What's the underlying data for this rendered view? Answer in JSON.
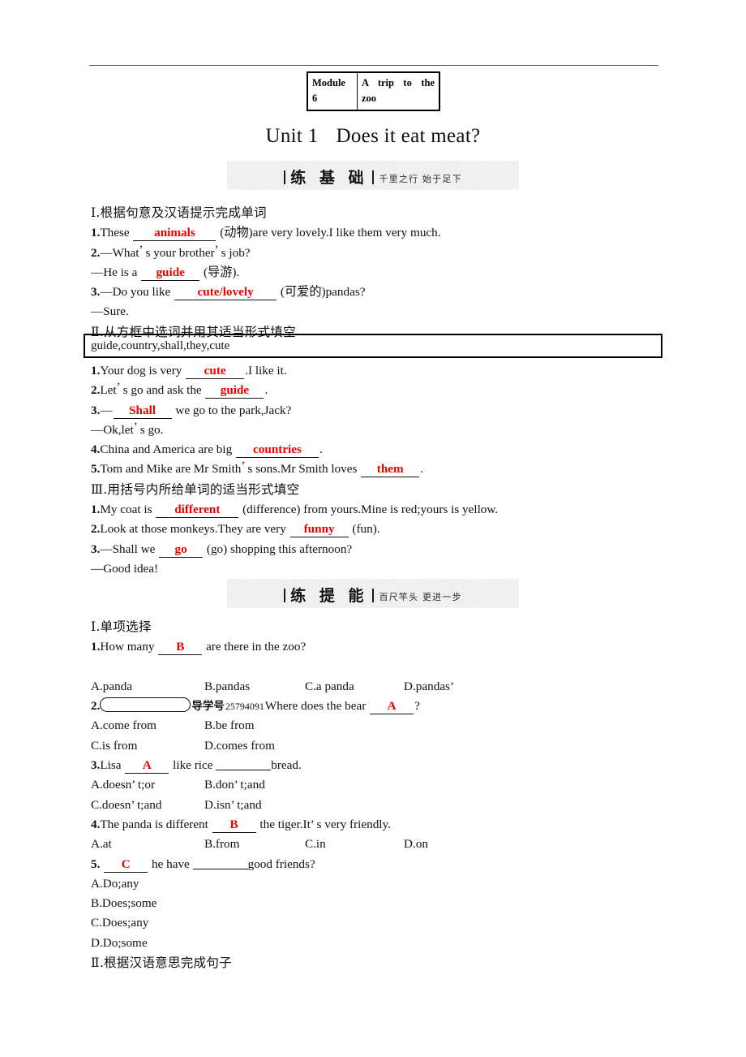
{
  "header": {
    "module_label": "Module",
    "module_number": "6",
    "module_topic_line1": "A trip to the",
    "module_topic_line2": "zoo"
  },
  "title": {
    "unit": "Unit 1",
    "name": "Does it eat meat?"
  },
  "banners": [
    {
      "name": "练 基 础",
      "motto": "千里之行  始于足下"
    },
    {
      "name": "练 提 能",
      "motto": "百尺竿头  更进一步"
    }
  ],
  "basics": {
    "section1": {
      "heading_numeral": "Ⅰ",
      "heading_text": ".根据句意及汉语提示完成单词",
      "items": [
        {
          "num": "1.",
          "pre": "These",
          "answer": "animals",
          "post": "(动物)are very lovely.I like them very much."
        },
        {
          "num": "2.",
          "q_pre": "—What",
          "q_mid": "s your brother",
          "q_post": "s job?",
          "a_pre": "—He is a",
          "answer": "guide",
          "a_post": "(导游)."
        },
        {
          "num": "3.",
          "q_pre": "—Do you like",
          "answer": "cute/lovely",
          "q_post": "(可爱的)pandas?",
          "reply": "—Sure."
        }
      ]
    },
    "section2": {
      "heading_numeral": "Ⅱ",
      "heading_text": ".从方框中选词并用其适当形式填空",
      "wordbank": "guide,country,shall,they,cute",
      "items": [
        {
          "num": "1.",
          "pre": "Your dog is very",
          "answer": "cute",
          "post": ".I like it."
        },
        {
          "num": "2.",
          "pre": "Let",
          "pre2": "s go and ask the",
          "answer": "guide",
          "post": "."
        },
        {
          "num": "3.",
          "pre": "—",
          "answer": "Shall",
          "post": "we go to the park,Jack?",
          "reply": "—Ok,let",
          "reply2": "s go."
        },
        {
          "num": "4.",
          "pre": "China and America are big",
          "answer": "countries",
          "post": "."
        },
        {
          "num": "5.",
          "pre": "Tom and Mike are Mr Smith",
          "pre2": "s sons.Mr Smith loves",
          "answer": "them",
          "post": "."
        }
      ]
    },
    "section3": {
      "heading_numeral": "Ⅲ",
      "heading_text": ".用括号内所给单词的适当形式填空",
      "items": [
        {
          "num": "1.",
          "pre": "My coat is",
          "answer": "different",
          "post": "(difference) from yours.Mine is red;yours is yellow."
        },
        {
          "num": "2.",
          "pre": "Look at those monkeys.They are very",
          "answer": "funny",
          "post": "(fun)."
        },
        {
          "num": "3.",
          "pre": "—Shall we",
          "answer": "go",
          "post": "(go) shopping this afternoon?",
          "reply": "—Good idea!"
        }
      ]
    }
  },
  "advanced": {
    "section1": {
      "heading_numeral": "Ⅰ",
      "heading_text": ".单项选择",
      "questions": [
        {
          "num": "1.",
          "stem_pre": "How many",
          "answer": "B",
          "stem_post": "are there in the zoo?",
          "options": [
            "A.panda",
            "B.pandas",
            "C.a panda",
            "D.pandas’"
          ],
          "layout": "row4"
        },
        {
          "num": "2.",
          "has_pill": true,
          "daoxue_label": "导学号",
          "daoxue_number": "25794091",
          "stem_pre": "Where does the bear",
          "answer": "A",
          "stem_post": "?",
          "options": [
            "A.come from",
            "B.be from",
            "C.is from",
            "D.comes from"
          ],
          "layout": "grid2"
        },
        {
          "num": "3.",
          "stem_pre": "Lisa",
          "answer": "A",
          "stem_mid": "like rice",
          "stem_post": "bread.",
          "options": [
            "A.doesn’ t;or",
            "B.don’ t;and",
            "C.doesn’ t;and",
            "D.isn’ t;and"
          ],
          "layout": "grid2"
        },
        {
          "num": "4.",
          "stem_pre": "The panda is different",
          "answer": "B",
          "stem_post": "the tiger.It’ s very friendly.",
          "options": [
            "A.at",
            "B.from",
            "C.in",
            "D.on"
          ],
          "layout": "row4"
        },
        {
          "num": "5.",
          "stem_pre": "",
          "answer": "C",
          "stem_mid": "he have",
          "stem_post": "good friends?",
          "options": [
            "A.Do;any",
            "B.Does;some",
            "C.Does;any",
            "D.Do;some"
          ],
          "layout": "stack"
        }
      ]
    },
    "section2": {
      "heading_numeral": "Ⅱ",
      "heading_text": ".根据汉语意思完成句子"
    }
  }
}
